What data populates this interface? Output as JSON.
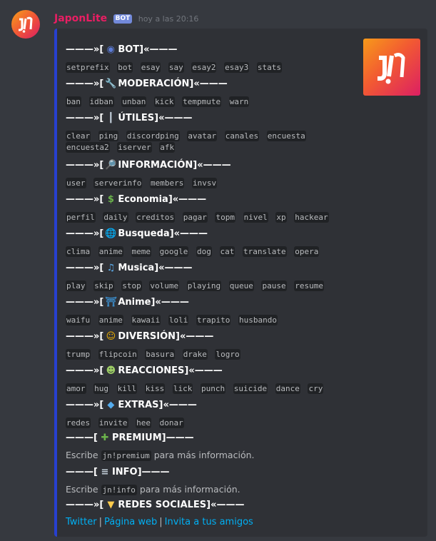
{
  "author": {
    "name": "JaponLite",
    "tag": "BOT",
    "time": "hoy a las 20:16"
  },
  "sections": [
    {
      "title_prefix": "———»[",
      "icon": "robot-icon",
      "icon_glyph": "◉",
      "icon_color": "#5b7bd6",
      "title": "BOT]«———",
      "commands": [
        "setprefix",
        "bot",
        "esay",
        "say",
        "esay2",
        "esay3",
        "stats"
      ]
    },
    {
      "title_prefix": "———»[",
      "icon": "wrench-icon",
      "icon_glyph": "🔧",
      "icon_color": "#8899a6",
      "title": "MODERACIÓN]«———",
      "commands": [
        "ban",
        "idban",
        "unban",
        "kick",
        "tempmute",
        "warn"
      ]
    },
    {
      "title_prefix": "———»[",
      "icon": "barber-pole-icon",
      "icon_glyph": "┃",
      "icon_color": "#c9d6e2",
      "title": "ÚTILES]«———",
      "commands": [
        "clear",
        "ping",
        "discordping",
        "avatar",
        "canales",
        "encuesta",
        "encuesta2",
        "iserver",
        "afk"
      ]
    },
    {
      "title_prefix": "———»[",
      "icon": "magnifier-icon",
      "icon_glyph": "🔎",
      "icon_color": "#9aa6b2",
      "title": "INFORMACIÓN]«———",
      "commands": [
        "user",
        "serverinfo",
        "members",
        "invsv"
      ]
    },
    {
      "title_prefix": "———»[",
      "icon": "money-icon",
      "icon_glyph": "$",
      "icon_color": "#6bb34b",
      "title": "Economia]«———",
      "commands": [
        "perfil",
        "daily",
        "creditos",
        "pagar",
        "topm",
        "nivel",
        "xp",
        "hackear"
      ]
    },
    {
      "title_prefix": "———»[",
      "icon": "globe-icon",
      "icon_glyph": "🌐",
      "icon_color": "#4aa8e0",
      "title": "Busqueda]«———",
      "commands": [
        "clima",
        "anime",
        "meme",
        "google",
        "dog",
        "cat",
        "translate",
        "opera"
      ]
    },
    {
      "title_prefix": "———»[",
      "icon": "music-notes-icon",
      "icon_glyph": "♫",
      "icon_color": "#5dadec",
      "title": " Musica]«———",
      "commands": [
        "play",
        "skip",
        "stop",
        "volume",
        "playing",
        "queue",
        "pause",
        "resume"
      ]
    },
    {
      "title_prefix": "———»[",
      "icon": "kimono-icon",
      "icon_glyph": "⛩",
      "icon_color": "#3b88c3",
      "title": "Anime]«———",
      "commands": [
        "waifu",
        "anime",
        "kawaii",
        "loli",
        "trapito",
        "husbando"
      ]
    },
    {
      "title_prefix": "———»[",
      "icon": "laughing-face-icon",
      "icon_glyph": "☺",
      "icon_color": "#f4b400",
      "title": "DIVERSIÓN]«———",
      "commands": [
        "trump",
        "flipcoin",
        "basura",
        "drake",
        "logro"
      ]
    },
    {
      "title_prefix": "———»[",
      "icon": "theater-masks-icon",
      "icon_glyph": "☻",
      "icon_color": "#9ccc65",
      "title": "REACCIONES]«———",
      "commands": [
        "amor",
        "hug",
        "kill",
        "kiss",
        "lick",
        "punch",
        "suicide",
        "dance",
        "cry"
      ]
    },
    {
      "title_prefix": "———»[",
      "icon": "diamond-shape-icon",
      "icon_glyph": "◆",
      "icon_color": "#55acee",
      "title": "EXTRAS]«———",
      "commands": [
        "redes",
        "invite",
        "hee",
        "donar"
      ]
    }
  ],
  "premium": {
    "title_prefix": "———[",
    "icon": "puzzle-icon",
    "icon_glyph": "✚",
    "icon_color": "#6bb34b",
    "title": "PREMIUM]———",
    "text_before": "Escribe ",
    "code": "jn!premium",
    "text_after": " para más información."
  },
  "info": {
    "title_prefix": "———[",
    "icon": "scroll-icon",
    "icon_glyph": "≡",
    "icon_color": "#c7d3dd",
    "title": "INFO]———",
    "text_before": "Escribe ",
    "code": "jn!info",
    "text_after": " para más información."
  },
  "social": {
    "title_prefix": "———»[",
    "icon": "beginner-icon",
    "icon_glyph": "▼",
    "icon_color": "#ffcc4d",
    "title": " REDES SOCIALES]«———",
    "links": [
      "Twitter",
      "Página web",
      "Invita a tus amigos"
    ],
    "separator": "|"
  }
}
